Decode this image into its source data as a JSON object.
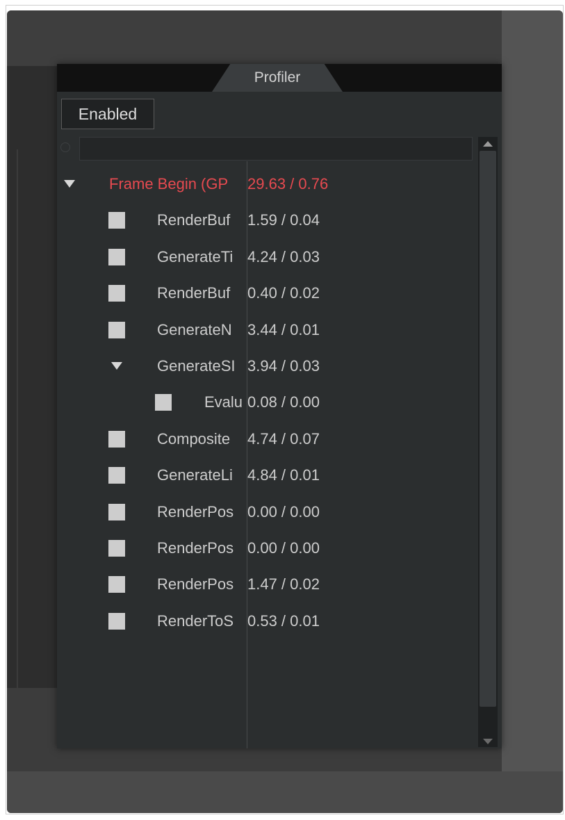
{
  "panel": {
    "tab_label": "Profiler",
    "enabled_label": "Enabled"
  },
  "tree": [
    {
      "name": "Frame Begin (GP",
      "values": "29.63 / 0.76",
      "level": 0,
      "expander": "triangle",
      "highlight": true
    },
    {
      "name": "RenderBuf",
      "values": "1.59 / 0.04",
      "level": 1,
      "expander": "square"
    },
    {
      "name": "GenerateTi",
      "values": "4.24 / 0.03",
      "level": 1,
      "expander": "square"
    },
    {
      "name": "RenderBuf",
      "values": "0.40 / 0.02",
      "level": 1,
      "expander": "square"
    },
    {
      "name": "GenerateN",
      "values": "3.44 / 0.01",
      "level": 1,
      "expander": "square"
    },
    {
      "name": "GenerateSI",
      "values": "3.94 / 0.03",
      "level": 1,
      "expander": "triangle"
    },
    {
      "name": "Evalu",
      "values": "0.08 / 0.00",
      "level": 2,
      "expander": "square"
    },
    {
      "name": "Composite",
      "values": "4.74 / 0.07",
      "level": 1,
      "expander": "square"
    },
    {
      "name": "GenerateLi",
      "values": "4.84 / 0.01",
      "level": 1,
      "expander": "square"
    },
    {
      "name": "RenderPos",
      "values": "0.00 / 0.00",
      "level": 1,
      "expander": "square"
    },
    {
      "name": "RenderPos",
      "values": "0.00 / 0.00",
      "level": 1,
      "expander": "square"
    },
    {
      "name": "RenderPos",
      "values": "1.47 / 0.02",
      "level": 1,
      "expander": "square"
    },
    {
      "name": "RenderToS",
      "values": "0.53 / 0.01",
      "level": 1,
      "expander": "square"
    }
  ],
  "colors": {
    "highlight": "#e74a50",
    "text": "#cdcdcd",
    "panel_bg": "#2b2e2f"
  }
}
